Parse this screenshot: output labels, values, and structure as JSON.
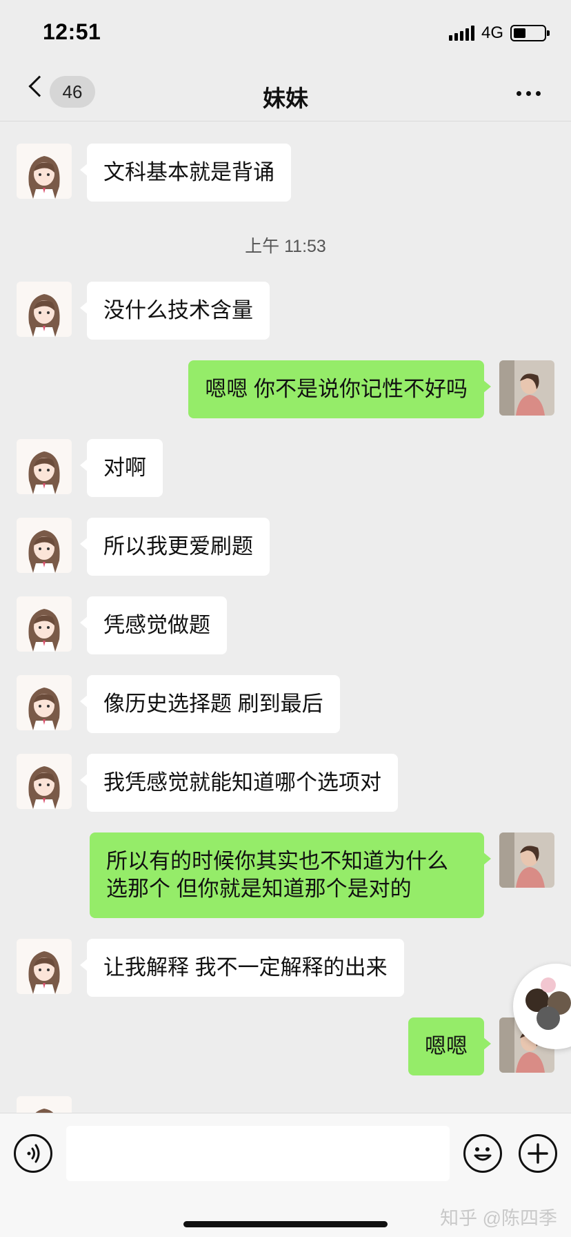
{
  "status_bar": {
    "time": "12:51",
    "network": "4G",
    "battery_level": 0.4
  },
  "header": {
    "unread_count": "46",
    "title": "妹妹"
  },
  "colors": {
    "self_bubble": "#95ec69",
    "other_bubble": "#ffffff",
    "background": "#ededed"
  },
  "messages": [
    {
      "side": "left",
      "text": "文科基本就是背诵"
    },
    {
      "type": "time",
      "text": "上午 11:53"
    },
    {
      "side": "left",
      "text": "没什么技术含量"
    },
    {
      "side": "right",
      "text": "嗯嗯 你不是说你记性不好吗"
    },
    {
      "side": "left",
      "text": "对啊"
    },
    {
      "side": "left",
      "text": "所以我更爱刷题"
    },
    {
      "side": "left",
      "text": "凭感觉做题"
    },
    {
      "side": "left",
      "text": "像历史选择题 刷到最后"
    },
    {
      "side": "left",
      "text": "我凭感觉就能知道哪个选项对"
    },
    {
      "side": "right",
      "text": "所以有的时候你其实也不知道为什么选那个 但你就是知道那个是对的"
    },
    {
      "side": "left",
      "text": "让我解释 我不一定解释的出来"
    },
    {
      "side": "right",
      "text": "嗯嗯"
    }
  ],
  "input_bar": {
    "voice_icon": "voice-icon",
    "emoji_icon": "emoji-icon",
    "plus_icon": "plus-icon"
  },
  "watermark": "知乎 @陈四季"
}
